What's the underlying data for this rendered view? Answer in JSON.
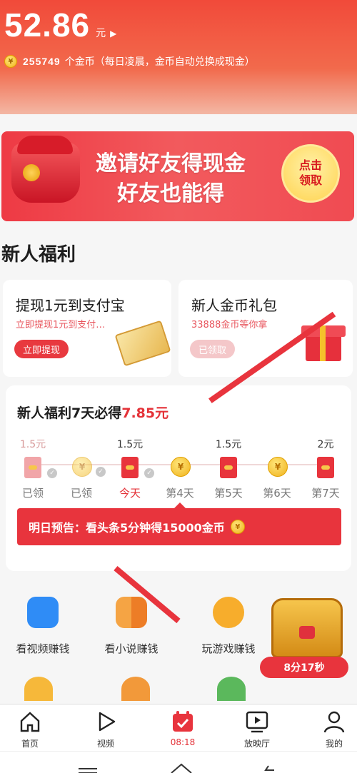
{
  "header": {
    "balance": "52.86",
    "balance_unit": "元",
    "coin_amount": "255749",
    "coin_text": "个金币（每日凌晨，金币自动兑换成现金）"
  },
  "banner": {
    "line1": "邀请好友得现金",
    "line2": "好友也能得",
    "button_line1": "点击",
    "button_line2": "领取"
  },
  "newbie": {
    "section_title": "新人福利",
    "card1": {
      "title": "提现1元到支付宝",
      "subtitle": "立即提现1元到支付…",
      "button": "立即提现"
    },
    "card2": {
      "title": "新人金币礼包",
      "subtitle": "33888金币等你拿",
      "button": "已领取"
    }
  },
  "week": {
    "title_prefix": "新人福利7天必得",
    "title_amount": "7.85元",
    "days": [
      {
        "value": "1.5元",
        "label": "已领",
        "type": "envelope",
        "claimed": true
      },
      {
        "value": "",
        "label": "已领",
        "type": "coin",
        "claimed": true
      },
      {
        "value": "1.5元",
        "label": "今天",
        "type": "envelope",
        "claimed": true
      },
      {
        "value": "",
        "label": "第4天",
        "type": "coin",
        "claimed": false
      },
      {
        "value": "1.5元",
        "label": "第5天",
        "type": "envelope",
        "claimed": false
      },
      {
        "value": "",
        "label": "第6天",
        "type": "coin",
        "claimed": false
      },
      {
        "value": "2元",
        "label": "第7天",
        "type": "envelope",
        "claimed": false
      }
    ],
    "preview": "明日预告：看头条5分钟得15000金币"
  },
  "tiles": [
    {
      "label": "看视频赚钱",
      "icon": "video-icon"
    },
    {
      "label": "看小说赚钱",
      "icon": "book-icon"
    },
    {
      "label": "玩游戏赚钱",
      "icon": "game-icon"
    }
  ],
  "float_timer": "8分17秒",
  "nav": [
    {
      "label": "首页",
      "icon": "home-icon"
    },
    {
      "label": "视频",
      "icon": "play-icon"
    },
    {
      "label": "08:18",
      "icon": "calendar-icon",
      "active": true
    },
    {
      "label": "放映厅",
      "icon": "screen-icon"
    },
    {
      "label": "我的",
      "icon": "user-icon"
    }
  ],
  "colors": {
    "accent": "#e8343d",
    "coin": "#f0b21c"
  }
}
